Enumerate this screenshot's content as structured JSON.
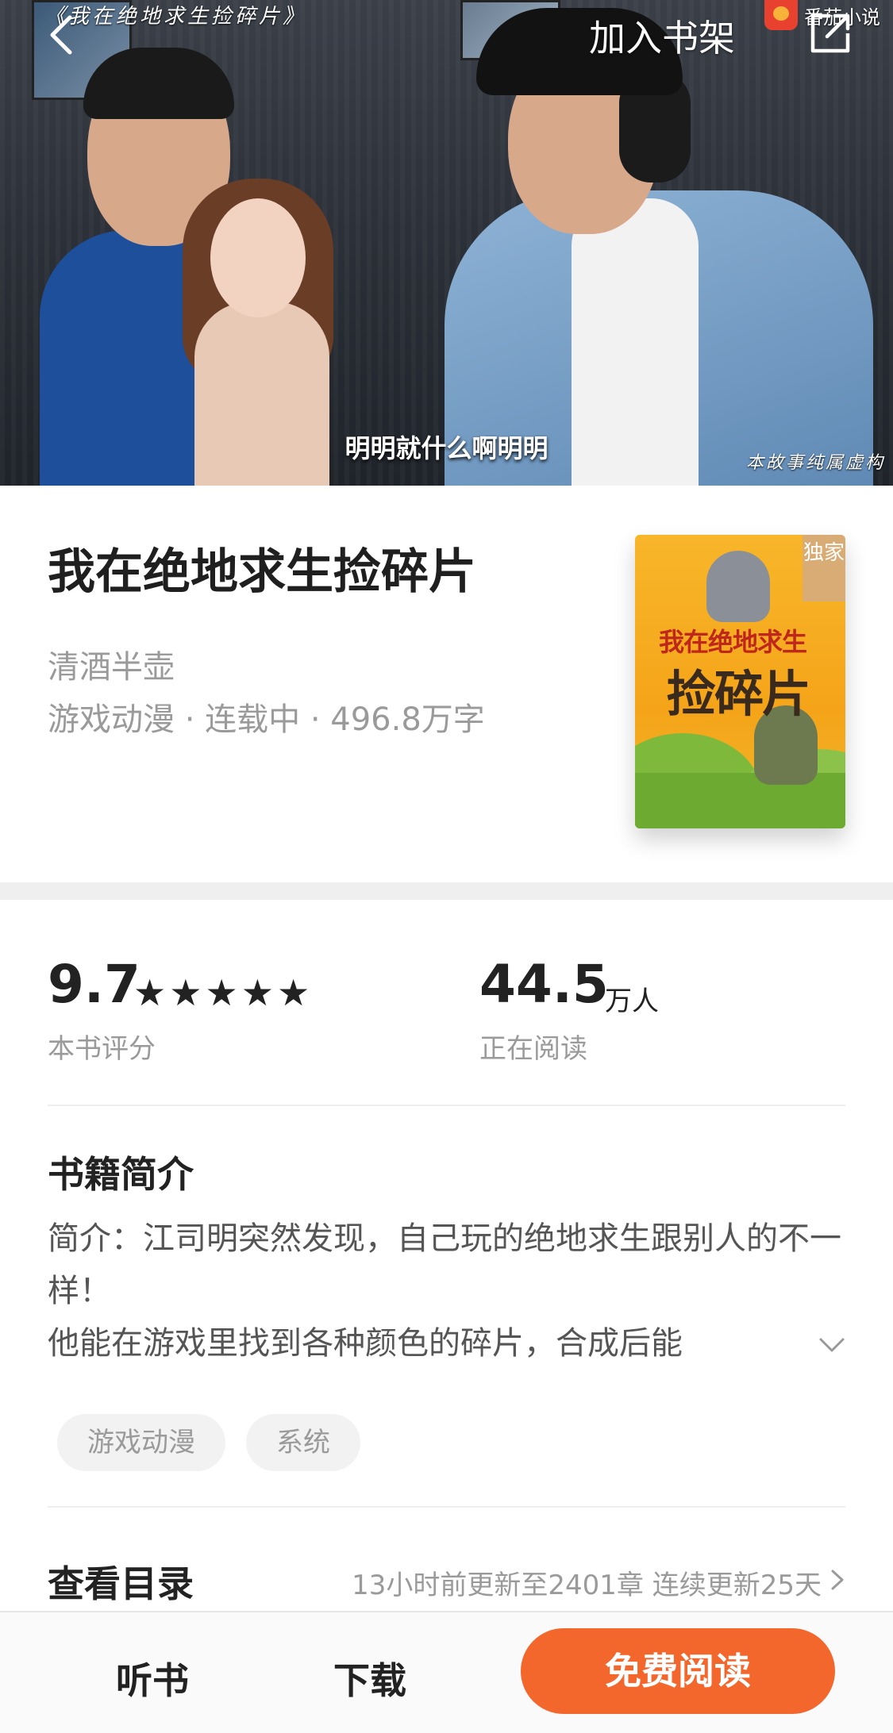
{
  "hero": {
    "top_caption": "《我在绝地求生捡碎片》",
    "subtitle": "明明就什么啊明明",
    "disclaimer": "本故事纯属虚构",
    "brand": "番茄小说"
  },
  "nav": {
    "add_to_shelf": "加入书架",
    "back_icon": "chevron-left-icon",
    "share_icon": "share-icon"
  },
  "book": {
    "title": "我在绝地求生捡碎片",
    "author": "清酒半壶",
    "meta": "游戏动漫 · 连载中 · 496.8万字",
    "cover": {
      "badge": "独家",
      "title_small": "我在绝地求生",
      "title_big": "捡碎片"
    }
  },
  "stats": {
    "rating": "9.7",
    "rating_stars": "★★★★★",
    "rating_label": "本书评分",
    "readers": "44.5",
    "readers_unit": "万人",
    "readers_label": "正在阅读"
  },
  "synopsis": {
    "title": "书籍简介",
    "text": "简介：江司明突然发现，自己玩的绝地求生跟别人的不一样！",
    "line3": "他能在游戏里找到各种颜色的碎片，合成后能"
  },
  "tags": [
    "游戏动漫",
    "系统"
  ],
  "catalog": {
    "title": "查看目录",
    "update": "13小时前更新至2401章  连续更新25天"
  },
  "bottom": {
    "listen": "听书",
    "download": "下载",
    "read": "免费阅读"
  },
  "colors": {
    "accent": "#f3672c",
    "muted": "#9a9a9a"
  }
}
